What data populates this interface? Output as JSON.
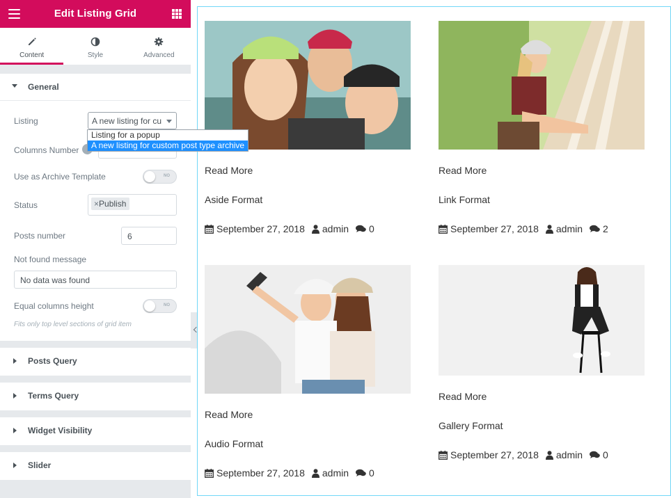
{
  "panel": {
    "title": "Edit Listing Grid",
    "tabs": [
      {
        "label": "Content",
        "icon": "pencil-icon"
      },
      {
        "label": "Style",
        "icon": "contrast-icon"
      },
      {
        "label": "Advanced",
        "icon": "gear-icon"
      }
    ],
    "general": {
      "heading": "General",
      "listing_label": "Listing",
      "listing_value": "A new listing for cu",
      "listing_options": [
        "Listing for a popup",
        "A new listing for custom post type archive"
      ],
      "columns_label": "Columns Number",
      "archive_label": "Use as Archive Template",
      "archive_toggle": "NO",
      "status_label": "Status",
      "status_chip": "Publish",
      "posts_label": "Posts number",
      "posts_value": "6",
      "notfound_label": "Not found message",
      "notfound_value": "No data was found",
      "equal_label": "Equal columns height",
      "equal_toggle": "NO",
      "equal_hint": "Fits only top level sections of grid item"
    },
    "sections": [
      "Posts Query",
      "Terms Query",
      "Widget Visibility",
      "Slider"
    ]
  },
  "posts": [
    {
      "read_more": "Read More",
      "title": "Aside Format",
      "date": "September 27, 2018",
      "author": "admin",
      "comments": "0"
    },
    {
      "read_more": "Read More",
      "title": "Link Format",
      "date": "September 27, 2018",
      "author": "admin",
      "comments": "2"
    },
    {
      "read_more": "Read More",
      "title": "Audio Format",
      "date": "September 27, 2018",
      "author": "admin",
      "comments": "0"
    },
    {
      "read_more": "Read More",
      "title": "Gallery Format",
      "date": "September 27, 2018",
      "author": "admin",
      "comments": "0"
    }
  ],
  "colors": {
    "accent": "#d30c5c",
    "panel_bg": "#e6e9ec",
    "preview_border": "#71d7f7",
    "selected_option": "#1e90ff"
  }
}
